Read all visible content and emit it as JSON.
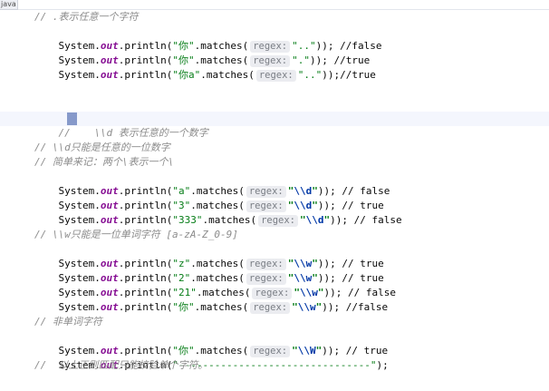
{
  "tab": {
    "label": "java"
  },
  "code": {
    "comment_dot": "// .表示任意一个字符",
    "dot_lines": [
      {
        "prefix": "System.",
        "field": "out",
        "method": ".println(",
        "literal": "\"你\"",
        "call": ".matches(",
        "hint": "regex:",
        "arg": "\"..\"",
        "suffix": ")); //false"
      },
      {
        "prefix": "System.",
        "field": "out",
        "method": ".println(",
        "literal": "\"你\"",
        "call": ".matches(",
        "hint": "regex:",
        "arg": "\".\"",
        "suffix": ")); //true"
      },
      {
        "prefix": "System.",
        "field": "out",
        "method": ".println(",
        "literal": "\"你a\"",
        "call": ".matches(",
        "hint": "regex:",
        "arg": "\"..\"",
        "suffix": "));//true"
      }
    ],
    "comment_d_current_1": "//    \\",
    "comment_d_current_2": "\\d 表示任意的一个数字",
    "comment_d_1": "// \\\\d只能是任意的一位数字",
    "comment_d_2": "// 简单来记：两个\\表示一个\\",
    "d_lines": [
      {
        "prefix": "System.",
        "field": "out",
        "method": ".println(",
        "literal": "\"a\"",
        "call": ".matches(",
        "hint": "regex:",
        "arg_q": "\"",
        "arg_esc": "\\\\d",
        "arg_q2": "\"",
        "suffix": ")); // false"
      },
      {
        "prefix": "System.",
        "field": "out",
        "method": ".println(",
        "literal": "\"3\"",
        "call": ".matches(",
        "hint": "regex:",
        "arg_q": "\"",
        "arg_esc": "\\\\d",
        "arg_q2": "\"",
        "suffix": ")); // true"
      },
      {
        "prefix": "System.",
        "field": "out",
        "method": ".println(",
        "literal": "\"333\"",
        "call": ".matches(",
        "hint": "regex:",
        "arg_q": "\"",
        "arg_esc": "\\\\d",
        "arg_q2": "\"",
        "suffix": ")); // false"
      }
    ],
    "comment_w": "// \\\\w只能是一位单词字符 [a-zA-Z_0-9]",
    "w_lines": [
      {
        "prefix": "System.",
        "field": "out",
        "method": ".println(",
        "literal": "\"z\"",
        "call": ".matches(",
        "hint": "regex:",
        "arg_q": "\"",
        "arg_esc": "\\\\w",
        "arg_q2": "\"",
        "suffix": ")); // true"
      },
      {
        "prefix": "System.",
        "field": "out",
        "method": ".println(",
        "literal": "\"2\"",
        "call": ".matches(",
        "hint": "regex:",
        "arg_q": "\"",
        "arg_esc": "\\\\w",
        "arg_q2": "\"",
        "suffix": ")); // true"
      },
      {
        "prefix": "System.",
        "field": "out",
        "method": ".println(",
        "literal": "\"21\"",
        "call": ".matches(",
        "hint": "regex:",
        "arg_q": "\"",
        "arg_esc": "\\\\w",
        "arg_q2": "\"",
        "suffix": ")); // false"
      },
      {
        "prefix": "System.",
        "field": "out",
        "method": ".println(",
        "literal": "\"你\"",
        "call": ".matches(",
        "hint": "regex:",
        "arg_q": "\"",
        "arg_esc": "\\\\w",
        "arg_q2": "\"",
        "suffix": ")); //false"
      }
    ],
    "comment_W": "// 非单词字符",
    "W_line": {
      "prefix": "System.",
      "field": "out",
      "method": ".println(",
      "literal": "\"你\"",
      "call": ".matches(",
      "hint": "regex:",
      "arg_q": "\"",
      "arg_esc": "\\\\W",
      "arg_q2": "\"",
      "suffix": ")); // true"
    },
    "sep_line": {
      "prefix": "System.",
      "field": "out",
      "method": ".println(",
      "literal": "\"--------------------------------\"",
      "suffix": ");"
    },
    "comment_end": "//  以上正则匹配只能校验单个字符。"
  },
  "colors": {
    "comment": "#8c8c8c",
    "field": "#871094",
    "string": "#067d17",
    "escape": "#0037a6",
    "hint_bg": "#ebecf0",
    "current_line_bg": "#f4f6fd"
  }
}
